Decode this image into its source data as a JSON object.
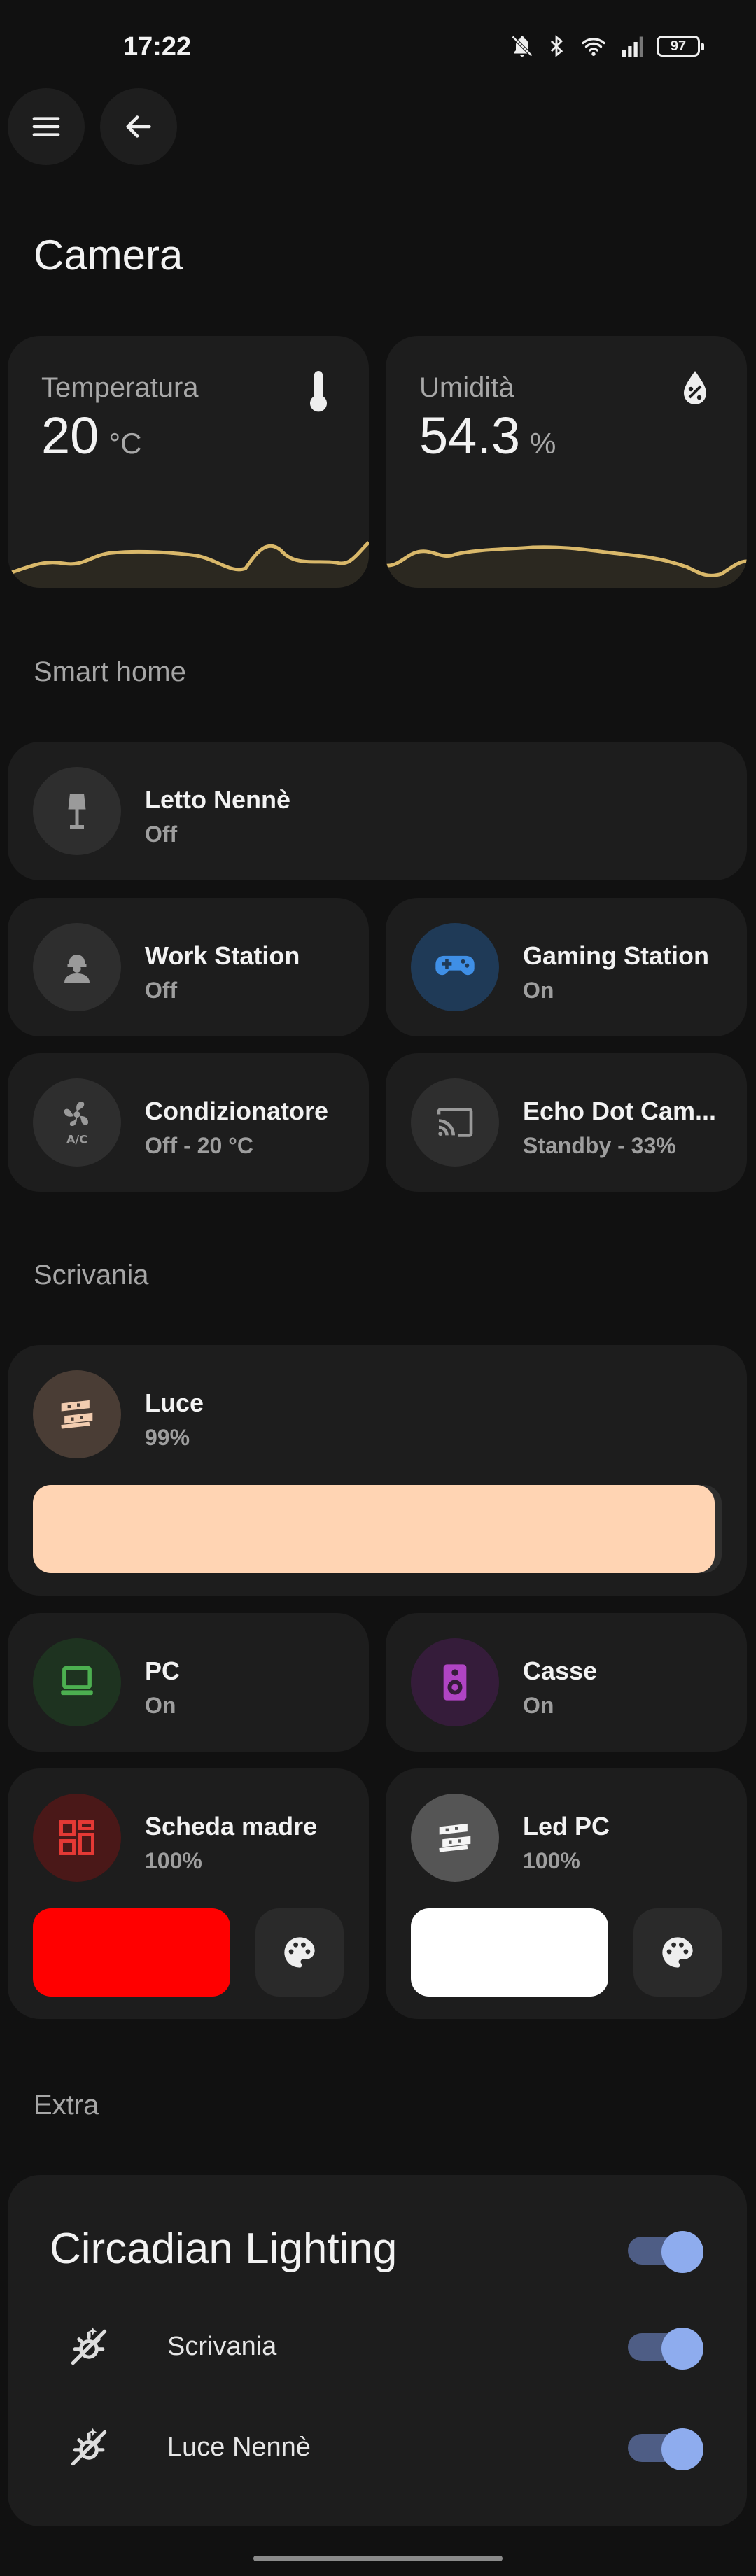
{
  "status_bar": {
    "time": "17:22",
    "battery": "97"
  },
  "page": {
    "title": "Camera"
  },
  "colors": {
    "accent_gold": "#d9b86a",
    "toggle_track": "#4e5d85",
    "toggle_knob": "#8eacee"
  },
  "sensors": [
    {
      "label": "Temperatura",
      "value": "20",
      "unit": "°C",
      "icon": "thermometer-icon"
    },
    {
      "label": "Umidità",
      "value": "54.3",
      "unit": "%",
      "icon": "humidity-drop-icon"
    }
  ],
  "sections": {
    "smart_home": "Smart home",
    "scrivania": "Scrivania",
    "extra": "Extra"
  },
  "smart_home": [
    {
      "name": "Letto Nennè",
      "state": "Off",
      "icon": "lamp-icon"
    },
    {
      "name": "Work Station",
      "state": "Off",
      "icon": "worker-icon"
    },
    {
      "name": "Gaming Station",
      "state": "On",
      "icon": "gamepad-icon"
    },
    {
      "name": "Condizionatore",
      "state": "Off - 20 °C",
      "icon": "fan-ac-icon"
    },
    {
      "name": "Echo Dot Cam...",
      "state": "Standby - 33%",
      "icon": "cast-icon"
    }
  ],
  "scrivania": {
    "luce": {
      "name": "Luce",
      "state": "99%",
      "brightness_percent": 99,
      "color": "#ffd4b3"
    },
    "pc": {
      "name": "PC",
      "state": "On"
    },
    "casse": {
      "name": "Casse",
      "state": "On"
    },
    "scheda_madre": {
      "name": "Scheda madre",
      "state": "100%",
      "color": "#ff0000"
    },
    "led_pc": {
      "name": "Led PC",
      "state": "100%",
      "color": "#ffffff"
    }
  },
  "extra": {
    "title": "Circadian Lighting",
    "enabled": true,
    "rows": [
      {
        "label": "Scrivania",
        "enabled": true
      },
      {
        "label": "Luce Nennè",
        "enabled": true
      }
    ]
  }
}
